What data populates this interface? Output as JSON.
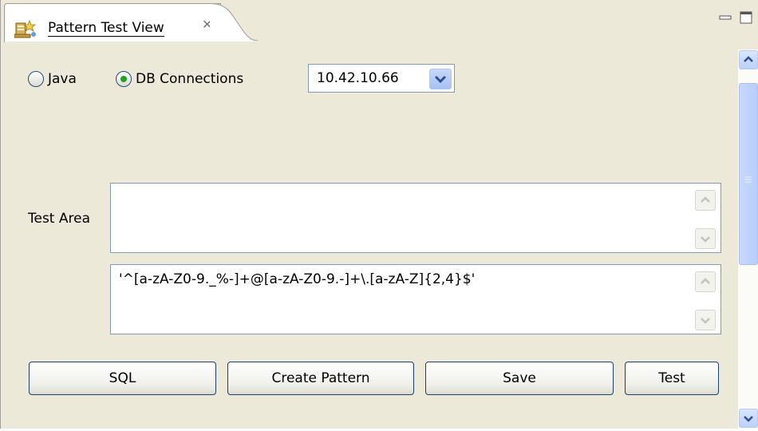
{
  "tab": {
    "title": "Pattern Test View",
    "icon": "pattern-view-icon",
    "close_icon": "close-icon"
  },
  "view_controls": {
    "minimize_icon": "minimize-icon",
    "maximize_icon": "maximize-icon"
  },
  "options": {
    "java_label": "Java",
    "db_label": "DB Connections",
    "selected": "DB Connections",
    "connection_value": "10.42.10.66"
  },
  "test_area": {
    "label": "Test Area",
    "value": ""
  },
  "pattern": {
    "value": "'^[a-zA-Z0-9._%-]+@[a-zA-Z0-9.-]+\\.[a-zA-Z]{2,4}$'"
  },
  "buttons": {
    "sql": "SQL",
    "create_pattern": "Create Pattern",
    "save": "Save",
    "test": "Test"
  },
  "colors": {
    "background": "#ece9d8",
    "border": "#7f9db9",
    "radio_selected": "#21a121",
    "scroll_accent": "#bcd0f8"
  }
}
